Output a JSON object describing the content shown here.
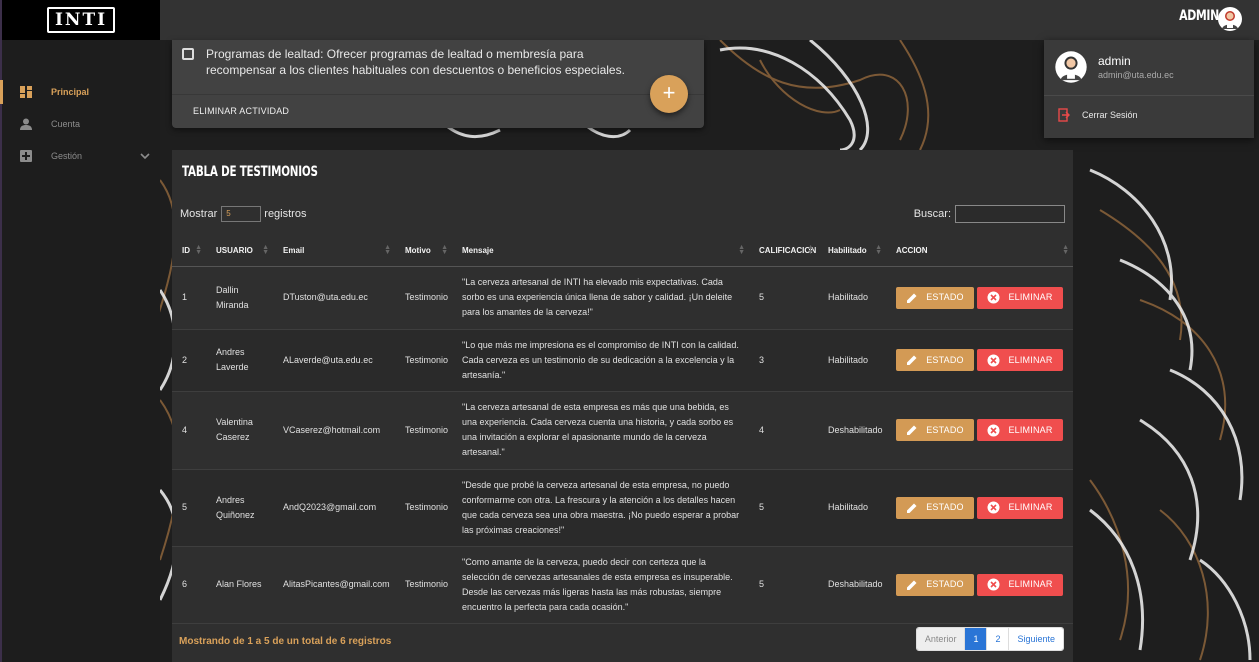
{
  "brand": {
    "logo_text": "INTI"
  },
  "topbar": {
    "user_label": "ADMIN"
  },
  "sidebar": {
    "items": [
      {
        "label": "Principal",
        "icon": "dashboard-icon",
        "active": true
      },
      {
        "label": "Cuenta",
        "icon": "person-icon",
        "active": false
      },
      {
        "label": "Gestión",
        "icon": "tools-icon",
        "active": false,
        "expandable": true
      }
    ]
  },
  "activity": {
    "text": "Programas de lealtad: Ofrecer programas de lealtad o membresía para recompensar a los clientes habituales con descuentos o beneficios especiales.",
    "delete_label": "ELIMINAR ACTIVIDAD",
    "add_label": "+"
  },
  "profile_menu": {
    "name": "admin",
    "email": "admin@uta.edu.ec",
    "logout_label": "Cerrar Sesión"
  },
  "testimonials": {
    "title": "TABLA DE TESTIMONIOS",
    "show_label": "Mostrar",
    "records_label": "registros",
    "page_length": "5",
    "search_label": "Buscar:",
    "search_value": "",
    "columns": [
      "ID",
      "USUARIO",
      "Email",
      "Motivo",
      "Mensaje",
      "CALIFICACION",
      "Habilitado",
      "ACCION"
    ],
    "rows": [
      {
        "id": "1",
        "usuario": "Dallin Miranda",
        "email": "DTuston@uta.edu.ec",
        "motivo": "Testimonio",
        "mensaje": "\"La cerveza artesanal de INTI ha elevado mis expectativas. Cada sorbo es una experiencia única llena de sabor y calidad. ¡Un deleite para los amantes de la cerveza!\"",
        "calificacion": "5",
        "habilitado": "Habilitado"
      },
      {
        "id": "2",
        "usuario": "Andres Laverde",
        "email": "ALaverde@uta.edu.ec",
        "motivo": "Testimonio",
        "mensaje": "\"Lo que más me impresiona es el compromiso de INTI con la calidad. Cada cerveza es un testimonio de su dedicación a la excelencia y la artesanía.\"",
        "calificacion": "3",
        "habilitado": "Habilitado"
      },
      {
        "id": "4",
        "usuario": "Valentina Caserez",
        "email": "VCaserez@hotmail.com",
        "motivo": "Testimonio",
        "mensaje": "\"La cerveza artesanal de esta empresa es más que una bebida, es una experiencia. Cada cerveza cuenta una historia, y cada sorbo es una invitación a explorar el apasionante mundo de la cerveza artesanal.\"",
        "calificacion": "4",
        "habilitado": "Deshabilitado"
      },
      {
        "id": "5",
        "usuario": "Andres Quiñonez",
        "email": "AndQ2023@gmail.com",
        "motivo": "Testimonio",
        "mensaje": "\"Desde que probé la cerveza artesanal de esta empresa, no puedo conformarme con otra. La frescura y la atención a los detalles hacen que cada cerveza sea una obra maestra. ¡No puedo esperar a probar las próximas creaciones!\"",
        "calificacion": "5",
        "habilitado": "Habilitado"
      },
      {
        "id": "6",
        "usuario": "Alan Flores",
        "email": "AlitasPicantes@gmail.com",
        "motivo": "Testimonio",
        "mensaje": "\"Como amante de la cerveza, puedo decir con certeza que la selección de cervezas artesanales de esta empresa es insuperable. Desde las cervezas más ligeras hasta las más robustas, siempre encuentro la perfecta para cada ocasión.\"",
        "calificacion": "5",
        "habilitado": "Deshabilitado"
      }
    ],
    "estado_label": "ESTADO",
    "eliminar_label": "ELIMINAR",
    "info": "Mostrando de 1 a 5 de un total de 6 registros",
    "pagination": {
      "prev": "Anterior",
      "pages": [
        "1",
        "2"
      ],
      "current": "1",
      "next": "Siguiente"
    }
  },
  "colors": {
    "accent": "#d9a15a",
    "danger": "#f04e4e",
    "primary": "#2a75d6",
    "card": "#2f2f2f"
  }
}
